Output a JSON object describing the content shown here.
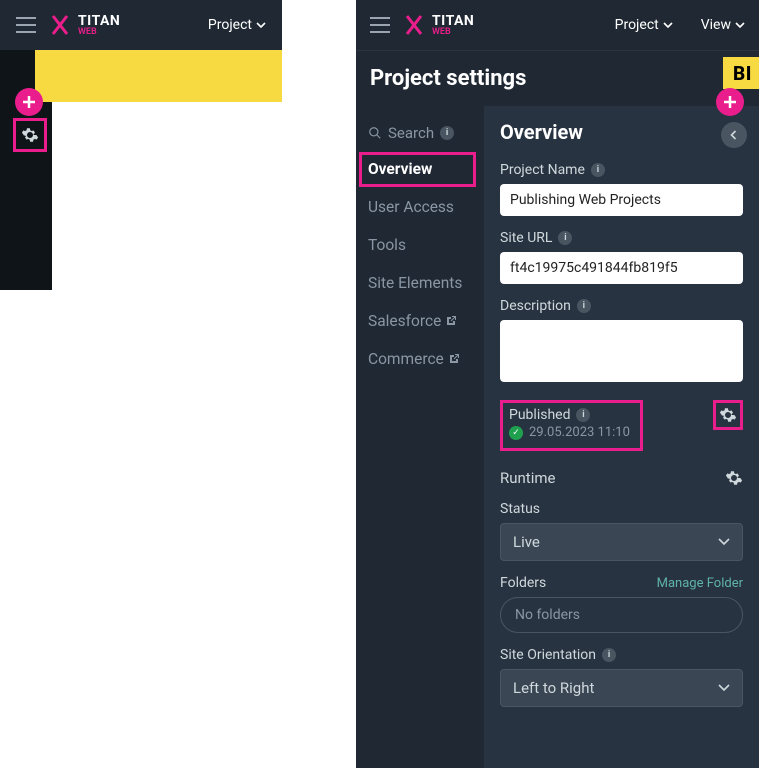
{
  "app": {
    "brand": "TITAN",
    "brand_sub": "WEB",
    "project_label": "Project",
    "view_label": "View"
  },
  "settings_title": "Project settings",
  "yellow_right_text": "BI",
  "nav": {
    "search": "Search",
    "items": [
      {
        "label": "Overview",
        "active": true
      },
      {
        "label": "User Access"
      },
      {
        "label": "Tools"
      },
      {
        "label": "Site Elements"
      },
      {
        "label": "Salesforce",
        "external": true
      },
      {
        "label": "Commerce",
        "external": true
      }
    ]
  },
  "overview": {
    "heading": "Overview",
    "project_name_label": "Project Name",
    "project_name_value": "Publishing Web Projects",
    "site_url_label": "Site URL",
    "site_url_value": "ft4c19975c491844fb819f5",
    "description_label": "Description",
    "description_value": "",
    "published_label": "Published",
    "published_date": "29.05.2023 11:10",
    "runtime_label": "Runtime",
    "status_label": "Status",
    "status_value": "Live",
    "folders_label": "Folders",
    "manage_folder": "Manage Folder",
    "folders_value": "No folders",
    "orientation_label": "Site Orientation",
    "orientation_value": "Left to Right"
  }
}
